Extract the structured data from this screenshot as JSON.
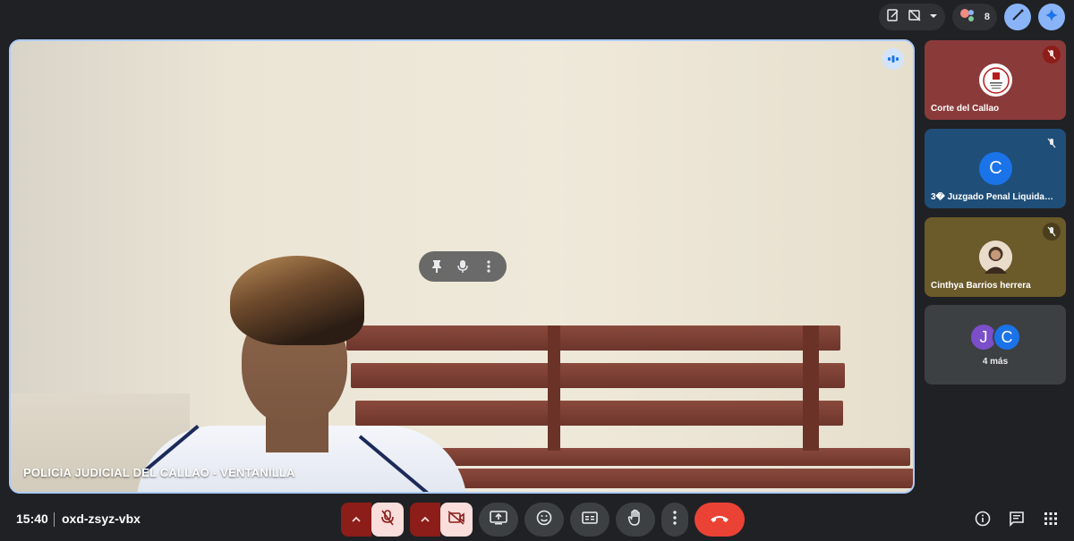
{
  "top_bar": {
    "participants_count": "8"
  },
  "stage": {
    "participant_label": "POLICIA JUDICIAL DEL CALLAO - VENTANILLA"
  },
  "tiles": [
    {
      "name": "Corte del Callao",
      "color": "#8b3a3a"
    },
    {
      "name": "3� Juzgado Penal Liquidad...",
      "avatar": "C",
      "avatar_color": "#1a73e8",
      "color": "#1f4e79"
    },
    {
      "name": "Cinthya Barrios herrera",
      "color": "#6b5a2a"
    }
  ],
  "more_tile": {
    "avatars": [
      "J",
      "C"
    ],
    "label": "4 más"
  },
  "footer": {
    "time": "15:40",
    "meeting_code": "oxd-zsyz-vbx"
  },
  "colors": {
    "background": "#202124",
    "stage_border": "#aecbfa",
    "end_call": "#ea4335",
    "muted_chip": "#8c1d18"
  }
}
